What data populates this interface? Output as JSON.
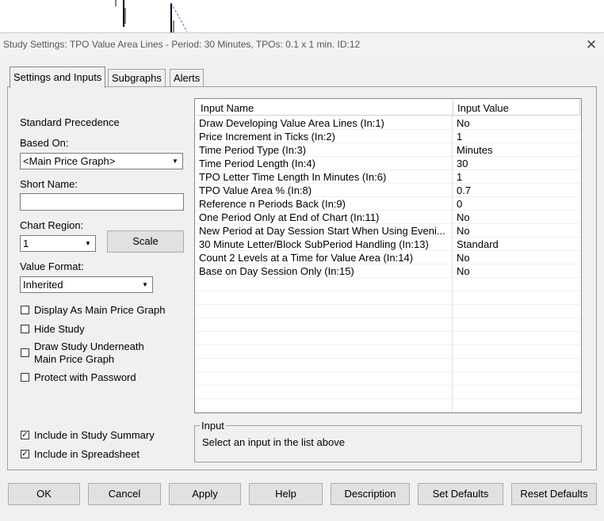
{
  "window": {
    "title": "Study Settings: TPO Value Area Lines - Period: 30 Minutes, TPOs: 0.1 x 1 min. ID:12"
  },
  "tabs": [
    {
      "label": "Settings and Inputs",
      "active": true
    },
    {
      "label": "Subgraphs",
      "active": false
    },
    {
      "label": "Alerts",
      "active": false
    }
  ],
  "left": {
    "standard_precedence": "Standard Precedence",
    "based_on_label": "Based On:",
    "based_on_value": "<Main Price Graph>",
    "short_name_label": "Short Name:",
    "short_name_value": "",
    "chart_region_label": "Chart Region:",
    "chart_region_value": "1",
    "scale_button": "Scale",
    "value_format_label": "Value Format:",
    "value_format_value": "Inherited",
    "checks": [
      {
        "label": "Display As Main Price Graph",
        "checked": false
      },
      {
        "label": "Hide Study",
        "checked": false
      },
      {
        "label": "Draw Study Underneath\nMain Price Graph",
        "checked": false
      },
      {
        "label": "Protect with Password",
        "checked": false
      }
    ],
    "include_summary": {
      "label": "Include in Study Summary",
      "checked": true
    },
    "include_spreadsheet": {
      "label": "Include in Spreadsheet",
      "checked": true
    }
  },
  "inputs_table": {
    "col_name": "Input Name",
    "col_value": "Input Value",
    "rows": [
      {
        "name": "Draw Developing Value Area Lines  (In:1)",
        "value": "No"
      },
      {
        "name": "Price Increment in Ticks  (In:2)",
        "value": "1"
      },
      {
        "name": "Time Period Type  (In:3)",
        "value": "Minutes"
      },
      {
        "name": "Time Period Length  (In:4)",
        "value": "30"
      },
      {
        "name": "TPO Letter Time Length In Minutes  (In:6)",
        "value": "1"
      },
      {
        "name": "TPO Value Area %  (In:8)",
        "value": "0.7"
      },
      {
        "name": "Reference n Periods Back  (In:9)",
        "value": "0"
      },
      {
        "name": "One Period Only at End of Chart  (In:11)",
        "value": "No"
      },
      {
        "name": "New Period at Day Session Start When Using Eveni...",
        "value": "No"
      },
      {
        "name": "30 Minute Letter/Block SubPeriod Handling  (In:13)",
        "value": "Standard"
      },
      {
        "name": "Count 2 Levels at a Time for Value Area  (In:14)",
        "value": "No"
      },
      {
        "name": "Base on Day Session Only  (In:15)",
        "value": "No"
      }
    ]
  },
  "input_group": {
    "legend": "Input",
    "text": "Select an input in the list above"
  },
  "buttons": {
    "ok": "OK",
    "cancel": "Cancel",
    "apply": "Apply",
    "help": "Help",
    "description": "Description",
    "set_defaults": "Set Defaults",
    "reset_defaults": "Reset Defaults"
  }
}
